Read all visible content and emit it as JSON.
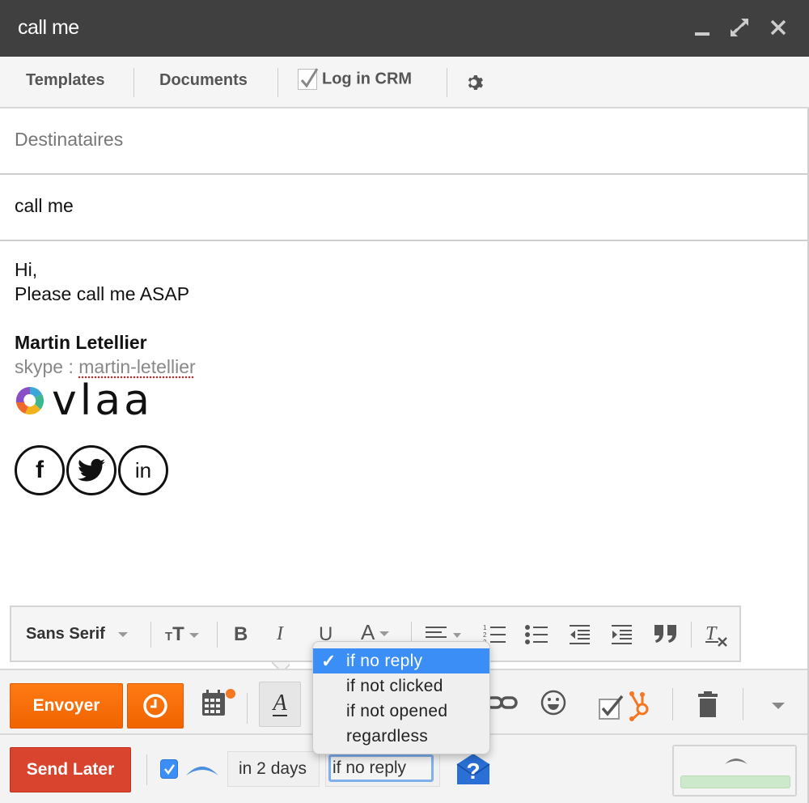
{
  "window": {
    "title": "call me",
    "controls": [
      "minimize-icon",
      "expand-icon",
      "close-icon"
    ]
  },
  "toolbar": {
    "templates": "Templates",
    "documents": "Documents",
    "log_in_crm": "Log in CRM",
    "log_in_crm_checked": true,
    "settings_icon": "gear-icon"
  },
  "recipients": {
    "placeholder": "Destinataires",
    "value": ""
  },
  "subject": {
    "value": "call me"
  },
  "body": {
    "greeting": "Hi,",
    "message": "Please call me ASAP",
    "signature": {
      "name": "Martin Letellier",
      "skype_label": "skype : ",
      "skype_handle": "martin-letellier",
      "logo_text": "vlaa",
      "social": [
        "f",
        "twitter",
        "in"
      ]
    }
  },
  "format_toolbar": {
    "font": "Sans Serif",
    "items": [
      "font-size-icon",
      "bold-icon",
      "italic-icon",
      "underline-icon",
      "text-color-icon",
      "align-icon",
      "numbered-list-icon",
      "bulleted-list-icon",
      "indent-less-icon",
      "indent-more-icon",
      "quote-icon",
      "remove-formatting-icon"
    ],
    "bold": "B",
    "italic": "I",
    "underline": "U",
    "textcolor": "A"
  },
  "send_bar": {
    "send_label": "Envoyer",
    "format_toggle": "A"
  },
  "later_bar": {
    "send_later_label": "Send Later",
    "followup_checked": true,
    "delay": "in 2 days",
    "condition": "if no reply"
  },
  "dropdown": {
    "options": [
      "if no reply",
      "if not clicked",
      "if not opened",
      "regardless"
    ],
    "selected": "if no reply",
    "check": "✓"
  },
  "colors": {
    "titlebar": "#404040",
    "send_orange": "#f96d07",
    "send_later_red": "#d9442e",
    "dropdown_selected": "#3b8ef5",
    "hubspot": "#f57722"
  }
}
